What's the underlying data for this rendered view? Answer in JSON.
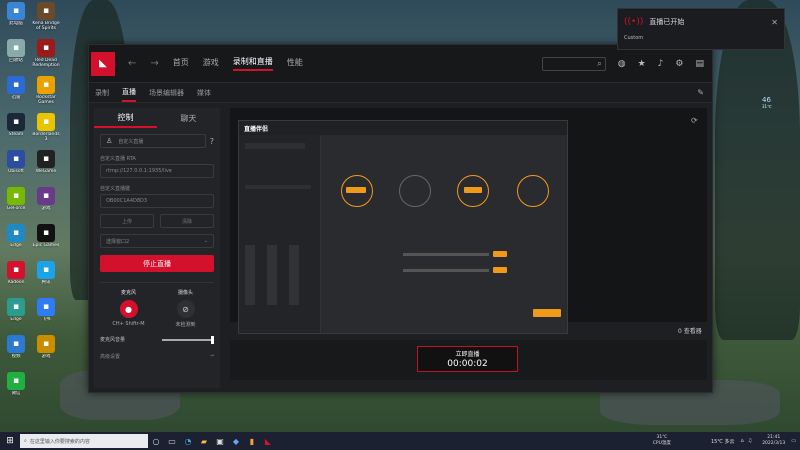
{
  "desktop": {
    "icons": [
      {
        "label": "此电脑",
        "icon": "computer-icon",
        "color": "#3a86d4"
      },
      {
        "label": "Kena Bridge of Spirits",
        "icon": "game-icon",
        "color": "#6b4a2a"
      },
      {
        "label": "回收站",
        "icon": "recycle-bin-icon",
        "color": "#8aa"
      },
      {
        "label": "Red Dead Redemption",
        "icon": "game-icon",
        "color": "#9b1b1b"
      },
      {
        "label": "迅雷",
        "icon": "app-icon",
        "color": "#2a6bd4"
      },
      {
        "label": "Rockstar Games",
        "icon": "rockstar-icon",
        "color": "#e9a200"
      },
      {
        "label": "Steam",
        "icon": "steam-icon",
        "color": "#1b2838"
      },
      {
        "label": "Borderlands 3",
        "icon": "game-icon",
        "color": "#e8c500"
      },
      {
        "label": "Ubisoft",
        "icon": "app-icon",
        "color": "#2b4ea0"
      },
      {
        "label": "WeGame",
        "icon": "app-icon",
        "color": "#222"
      },
      {
        "label": "GeForce",
        "icon": "app-icon",
        "color": "#76b900"
      },
      {
        "label": "游戏",
        "icon": "game-icon",
        "color": "#6a3a8a"
      },
      {
        "label": "Edge",
        "icon": "edge-icon",
        "color": "#1d8ac6"
      },
      {
        "label": "Epic Games",
        "icon": "epic-icon",
        "color": "#111"
      },
      {
        "label": "Radeon",
        "icon": "amd-icon",
        "color": "#d3112d"
      },
      {
        "label": "腾讯",
        "icon": "app-icon",
        "color": "#1aa3e8"
      },
      {
        "label": "Edge",
        "icon": "edge-icon",
        "color": "#2a9d8f"
      },
      {
        "label": "飞书",
        "icon": "app-icon",
        "color": "#2e7bf6"
      },
      {
        "label": "视频",
        "icon": "app-icon",
        "color": "#2a7ad4"
      },
      {
        "label": "游戏",
        "icon": "game-icon",
        "color": "#c98d00"
      },
      {
        "label": "微信",
        "icon": "wechat-icon",
        "color": "#20b040"
      }
    ]
  },
  "app": {
    "nav": {
      "back": "←",
      "forward": "→",
      "tabs": [
        "首页",
        "游戏",
        "录制和直播",
        "性能"
      ],
      "active_tab": "录制和直播"
    },
    "subtabs": [
      "录制",
      "直播",
      "场景编辑器",
      "媒体"
    ],
    "active_subtab": "直播",
    "left": {
      "tabs": [
        "控制",
        "聊天"
      ],
      "platform_placeholder": "自定义直播",
      "url_label": "自定义直播 RTA",
      "url_value": "rtmp://127.0.0.1:1935/live",
      "key_label": "自定义直播键",
      "key_value": "OB00C1A4D8D3",
      "btn1": "上传",
      "btn2": "清除",
      "select_value": "选择窗口2",
      "stop_button": "停止直播",
      "mic_label": "麦克风",
      "mic_device": "CH+ Shiftr-M",
      "cam_label": "摄像头",
      "cam_device": "未检测到",
      "mic_volume_label": "麦克风音量",
      "advanced_label": "高级设置",
      "mic_volume": 0.95
    },
    "preview": {
      "inner_title": "直播伴侣",
      "live_label": "立即直播",
      "timer": "00:00:02",
      "viewers": "0 查看器"
    }
  },
  "toast": {
    "title": "直播已开始",
    "subtitle": "Custom"
  },
  "widget": {
    "pct": "46",
    "temp": "31℃"
  },
  "taskbar": {
    "search_placeholder": "在这里输入你要搜索的内容",
    "weather": "31℃",
    "weather_sub": "CPU温度",
    "temp2": "15℃ 多云",
    "time": "21:41",
    "date": "2022/3/13"
  }
}
